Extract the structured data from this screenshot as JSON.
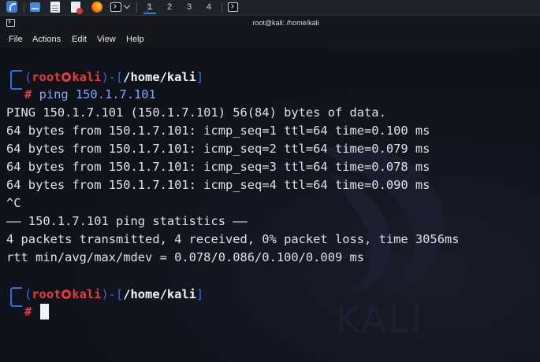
{
  "taskbar": {
    "workspaces": [
      "1",
      "2",
      "3",
      "4"
    ],
    "active_workspace": "1"
  },
  "window": {
    "title": "root@kali: /home/kali"
  },
  "menubar": {
    "items": [
      "File",
      "Actions",
      "Edit",
      "View",
      "Help"
    ]
  },
  "terminal": {
    "watermark": "KALI",
    "prompt": {
      "open_paren": "(",
      "user": "root",
      "host": "kali",
      "mid": ")-[",
      "path": "/home/kali",
      "close": "]",
      "symbol": "#"
    },
    "command": "ping 150.1.7.101",
    "output": [
      "PING 150.1.7.101 (150.1.7.101) 56(84) bytes of data.",
      "64 bytes from 150.1.7.101: icmp_seq=1 ttl=64 time=0.100 ms",
      "64 bytes from 150.1.7.101: icmp_seq=2 ttl=64 time=0.079 ms",
      "64 bytes from 150.1.7.101: icmp_seq=3 ttl=64 time=0.078 ms",
      "64 bytes from 150.1.7.101: icmp_seq=4 ttl=64 time=0.090 ms",
      "^C",
      "—— 150.1.7.101 ping statistics ——",
      "4 packets transmitted, 4 received, 0% packet loss, time 3056ms",
      "rtt min/avg/max/mdev = 0.078/0.086/0.100/0.009 ms"
    ]
  },
  "colors": {
    "prompt_frame": "#2a6ee8",
    "prompt_user": "#e33b3b",
    "command": "#86a8f5",
    "background": "#10121b"
  }
}
